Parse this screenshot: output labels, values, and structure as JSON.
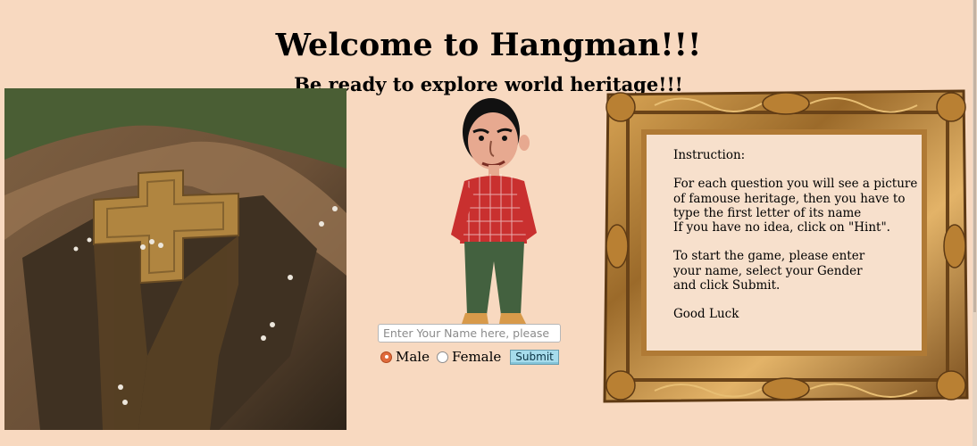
{
  "header": {
    "title": "Welcome to Hangman!!!",
    "subtitle": "Be ready to explore world heritage!!!"
  },
  "images": {
    "heritage": "heritage-site-photo",
    "character": "cartoon-character",
    "frame": "ornate-gold-frame"
  },
  "form": {
    "name_placeholder": "Enter Your Name here, please",
    "name_value": "",
    "male_label": "Male",
    "female_label": "Female",
    "selected_gender": "Male",
    "submit_label": "Submit"
  },
  "instructions": {
    "text": "Instruction:\n\nFor each question you will see a picture\nof famouse heritage, then you have to\ntype the first letter of its name\nIf you have no idea, click on \"Hint\".\n\nTo start the game, please enter\nyour name, select your Gender\nand click Submit.\n\nGood Luck"
  },
  "colors": {
    "background": "#f8d9c0",
    "accent_radio": "#e06b3c",
    "button": "#a6dcec"
  }
}
